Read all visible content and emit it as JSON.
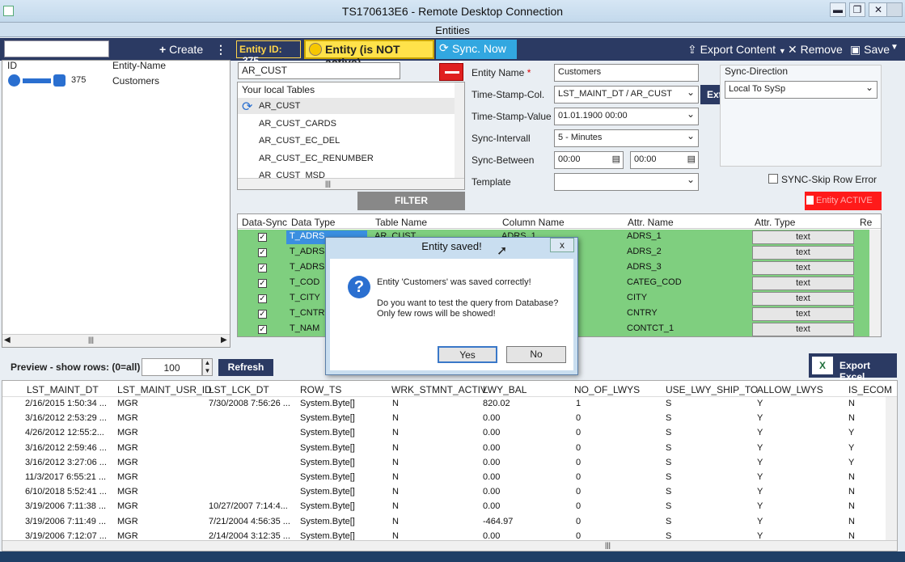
{
  "rdp": {
    "title": "TS170613E6 - Remote Desktop Connection",
    "min": "▬",
    "restore": "❐",
    "close": "✕"
  },
  "app": {
    "title": "Entities"
  },
  "toolbar": {
    "create": "Create",
    "entity_id_label": "Entity ID:",
    "entity_id": "375",
    "status": "Entity (is NOT active)",
    "sync_now": "Sync. Now",
    "export_content": "Export Content",
    "remove": "Remove",
    "save": "Save"
  },
  "left": {
    "col_id": "ID",
    "col_name": "Entity-Name",
    "row_id": "375",
    "row_name": "Customers"
  },
  "center": {
    "table_input": "AR_CUST",
    "tables_header": "Your local Tables",
    "tables": [
      "AR_CUST",
      "AR_CUST_CARDS",
      "AR_CUST_EC_DEL",
      "AR_CUST_EC_RENUMBER",
      "AR_CUST_MSD"
    ],
    "filter": "FILTER"
  },
  "form": {
    "entity_name_label": "Entity Name",
    "required_mark": "*",
    "entity_name": "Customers",
    "ts_col_label": "Time-Stamp-Col.",
    "ts_col": "LST_MAINT_DT / AR_CUST",
    "ts_value_label": "Time-Stamp-Value",
    "ts_value": "01.01.1900 00:00",
    "interval_label": "Sync-Intervall",
    "interval": "5 - Minutes",
    "between_label": "Sync-Between",
    "between_from": "00:00",
    "between_to": "00:00",
    "template_label": "Template",
    "template": "",
    "ext": "Ext.",
    "sync_dir_label": "Sync-Direction",
    "sync_dir": "Local To SySp",
    "skip_error": "SYNC-Skip Row Error",
    "entity_active": "Entity ACTIVE"
  },
  "grid": {
    "headers": [
      "Data-Sync",
      "Data Type",
      "Table Name",
      "Column Name",
      "Attr. Name",
      "Attr. Type",
      "Re"
    ],
    "rows": [
      {
        "type": "T_ADRS",
        "table": "AR_CUST",
        "column": "ADRS_1",
        "attr": "ADRS_1",
        "atype": "text"
      },
      {
        "type": "T_ADRS",
        "table": "",
        "column": "",
        "attr": "ADRS_2",
        "atype": "text"
      },
      {
        "type": "T_ADRS",
        "table": "",
        "column": "",
        "attr": "ADRS_3",
        "atype": "text"
      },
      {
        "type": "T_COD",
        "table": "",
        "column": "",
        "attr": "CATEG_COD",
        "atype": "text"
      },
      {
        "type": "T_CITY",
        "table": "",
        "column": "",
        "attr": "CITY",
        "atype": "text"
      },
      {
        "type": "T_CNTRY",
        "table": "",
        "column": "",
        "attr": "CNTRY",
        "atype": "text"
      },
      {
        "type": "T_NAM",
        "table": "",
        "column": "",
        "attr": "CONTCT_1",
        "atype": "text"
      }
    ]
  },
  "preview": {
    "label": "Preview - show rows: (0=all)",
    "rows": "100",
    "refresh": "Refresh",
    "export_excel": "Export Excel",
    "headers": [
      "LST_MAINT_DT",
      "LST_MAINT_USR_ID",
      "LST_LCK_DT",
      "ROW_TS",
      "WRK_STMNT_ACTIV",
      "LWY_BAL",
      "NO_OF_LWYS",
      "USE_LWY_SHIP_TO",
      "ALLOW_LWYS",
      "IS_ECOM"
    ],
    "data": [
      [
        "2/16/2015 1:50:34 ...",
        "MGR",
        "7/30/2008 7:56:26 ...",
        "System.Byte[]",
        "N",
        "820.02",
        "1",
        "S",
        "Y",
        "N"
      ],
      [
        "3/16/2012 2:53:29 ...",
        "MGR",
        "",
        "System.Byte[]",
        "N",
        "0.00",
        "0",
        "S",
        "Y",
        "N"
      ],
      [
        "4/26/2012 12:55:2...",
        "MGR",
        "",
        "System.Byte[]",
        "N",
        "0.00",
        "0",
        "S",
        "Y",
        "Y"
      ],
      [
        "3/16/2012 2:59:46 ...",
        "MGR",
        "",
        "System.Byte[]",
        "N",
        "0.00",
        "0",
        "S",
        "Y",
        "Y"
      ],
      [
        "3/16/2012 3:27:06 ...",
        "MGR",
        "",
        "System.Byte[]",
        "N",
        "0.00",
        "0",
        "S",
        "Y",
        "Y"
      ],
      [
        "11/3/2017 6:55:21 ...",
        "MGR",
        "",
        "System.Byte[]",
        "N",
        "0.00",
        "0",
        "S",
        "Y",
        "N"
      ],
      [
        "6/10/2018 5:52:41 ...",
        "MGR",
        "",
        "System.Byte[]",
        "N",
        "0.00",
        "0",
        "S",
        "Y",
        "N"
      ],
      [
        "3/19/2006 7:11:38 ...",
        "MGR",
        "10/27/2007 7:14:4...",
        "System.Byte[]",
        "N",
        "0.00",
        "0",
        "S",
        "Y",
        "N"
      ],
      [
        "3/19/2006 7:11:49 ...",
        "MGR",
        "7/21/2004 4:56:35 ...",
        "System.Byte[]",
        "N",
        "-464.97",
        "0",
        "S",
        "Y",
        "N"
      ],
      [
        "3/19/2006 7:12:07 ...",
        "MGR",
        "2/14/2004 3:12:35 ...",
        "System.Byte[]",
        "N",
        "0.00",
        "0",
        "S",
        "Y",
        "N"
      ]
    ]
  },
  "dialog": {
    "title": "Entity saved!",
    "close": "x",
    "line1": "Entity 'Customers' was saved correctly!",
    "line2": "Do you want to test the query from Database?",
    "line3": "Only few rows will be showed!",
    "yes": "Yes",
    "no": "No"
  },
  "colors": {
    "accent": "#2b3a63",
    "warning": "#ffe24a",
    "sync": "#32a7e0",
    "grid_row": "#7fcf7f",
    "active": "#ff1a1a"
  }
}
